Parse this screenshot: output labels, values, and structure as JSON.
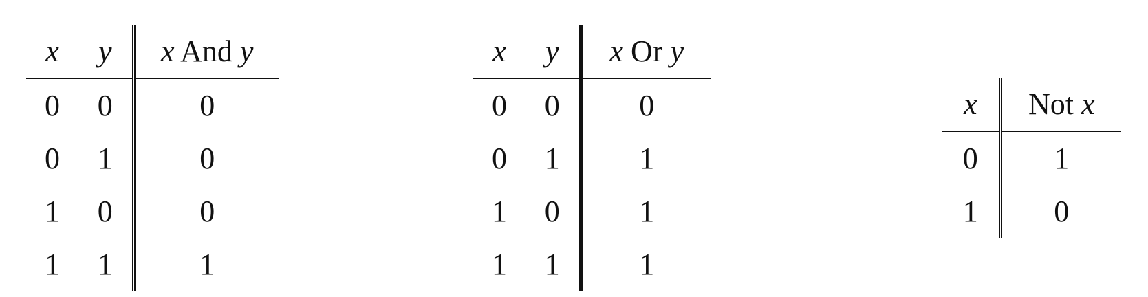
{
  "and_table": {
    "headers": {
      "x": "x",
      "y": "y",
      "result_var1": "x",
      "result_op": "And",
      "result_var2": "y"
    },
    "rows": [
      [
        "0",
        "0",
        "0"
      ],
      [
        "0",
        "1",
        "0"
      ],
      [
        "1",
        "0",
        "0"
      ],
      [
        "1",
        "1",
        "1"
      ]
    ]
  },
  "or_table": {
    "headers": {
      "x": "x",
      "y": "y",
      "result_var1": "x",
      "result_op": "Or",
      "result_var2": "y"
    },
    "rows": [
      [
        "0",
        "0",
        "0"
      ],
      [
        "0",
        "1",
        "1"
      ],
      [
        "1",
        "0",
        "1"
      ],
      [
        "1",
        "1",
        "1"
      ]
    ]
  },
  "not_table": {
    "headers": {
      "x": "x",
      "result_op": "Not",
      "result_var": "x"
    },
    "rows": [
      [
        "0",
        "1"
      ],
      [
        "1",
        "0"
      ]
    ]
  }
}
